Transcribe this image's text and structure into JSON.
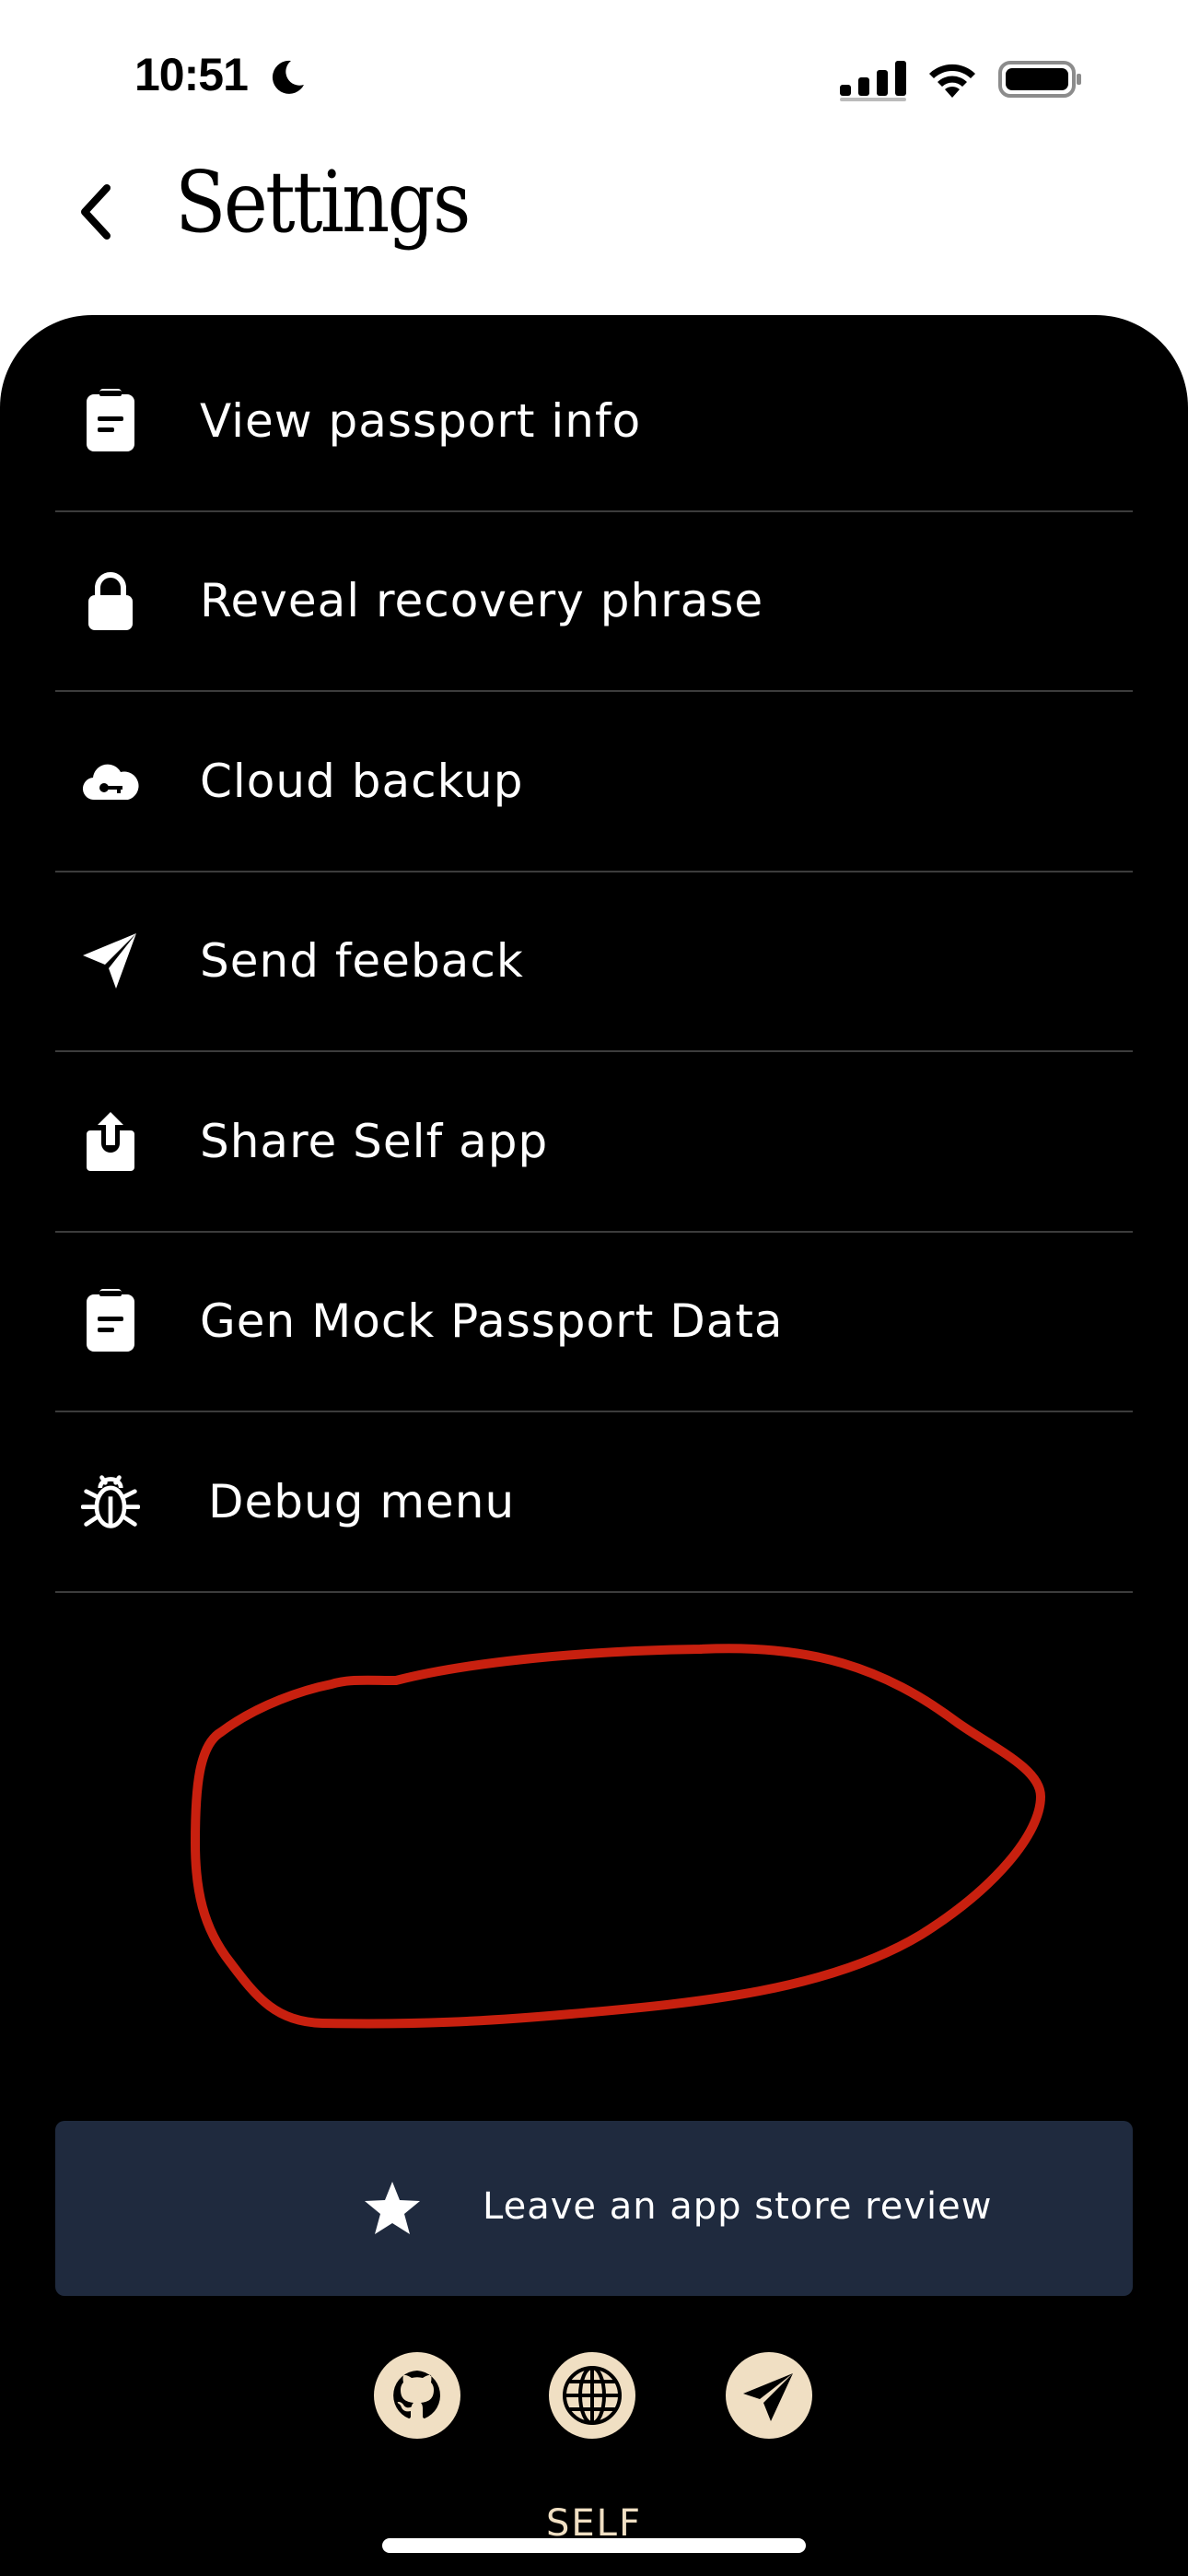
{
  "status_bar": {
    "time": "10:51"
  },
  "header": {
    "title": "Settings"
  },
  "menu": {
    "items": [
      {
        "label": "View passport info",
        "icon": "clipboard-icon"
      },
      {
        "label": "Reveal recovery phrase",
        "icon": "lock-icon"
      },
      {
        "label": "Cloud backup",
        "icon": "cloud-key-icon"
      },
      {
        "label": "Send feeback",
        "icon": "paper-plane-icon"
      },
      {
        "label": "Share Self app",
        "icon": "share-icon"
      },
      {
        "label": "Gen Mock Passport Data",
        "icon": "clipboard-icon"
      },
      {
        "label": "Debug menu",
        "icon": "bug-icon"
      }
    ]
  },
  "review": {
    "label": "Leave an app store review",
    "icon": "star-icon"
  },
  "social": [
    {
      "icon": "github-icon"
    },
    {
      "icon": "globe-icon"
    },
    {
      "icon": "telegram-icon"
    }
  ],
  "brand": "SELF",
  "colors": {
    "panel": "#000000",
    "review_bg": "#1f2a3e",
    "accent_cream": "#f0dfc3",
    "annotation_red": "#c8200f",
    "divider": "#3c3c3c"
  }
}
